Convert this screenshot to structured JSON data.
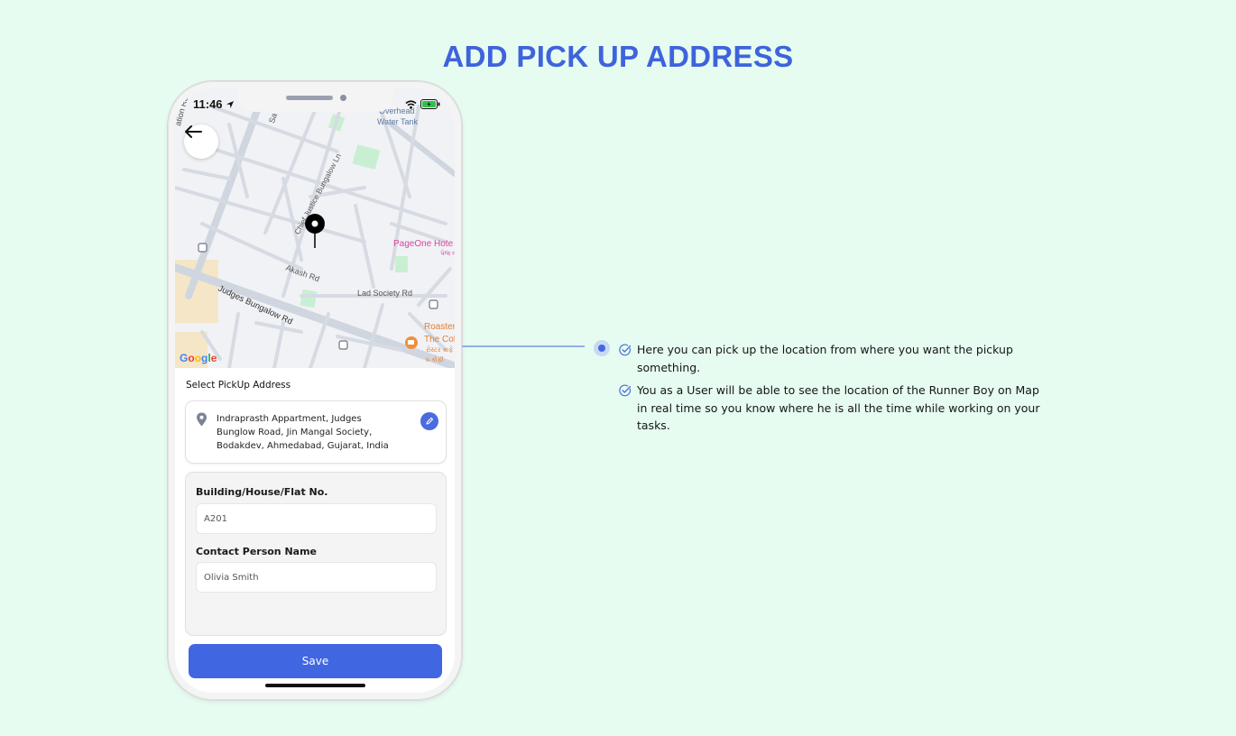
{
  "page": {
    "title": "ADD PICK UP ADDRESS"
  },
  "phone": {
    "status_time": "11:46",
    "map": {
      "labels": {
        "station_road": "ation Rd",
        "sarkhej_road": "Sa",
        "overhead": "Overhead",
        "water_tank": "Water Tank",
        "chief_bungalow_ln": "Chief Justice Bungalow Ln",
        "pageone_hotel": "PageOne Hote",
        "pageone_gujarati": "પેજ વ",
        "akash_rd": "Akash Rd",
        "lad_society_rd": "Lad Society Rd",
        "judges_bungalow_rd": "Judges Bungalow Rd",
        "roaster": "Roaster",
        "the_cof": "The Cof",
        "gujarati_cafe_1": "રોસ્ટર કાફે",
        "gujarati_cafe_2": "ધ કોફી"
      },
      "google": {
        "g1": "G",
        "o1": "o",
        "o2": "o",
        "g2": "g",
        "l": "l",
        "e": "e"
      }
    },
    "sheet": {
      "heading": "Select PickUp Address",
      "address_lines": [
        "Indraprasth Appartment, Judges",
        "Bunglow Road, Jin Mangal Society,",
        "Bodakdev, Ahmedabad, Gujarat, India"
      ],
      "building_label": "Building/House/Flat No.",
      "building_value": "A201",
      "contact_label": "Contact Person Name",
      "contact_value": "Olivia Smith",
      "save_label": "Save"
    }
  },
  "callout": {
    "notes": [
      "Here you can pick up the location from where you want the pickup something.",
      "You as a User will be able to see the location of the Runner Boy on Map in real time so you know where he is all the time while working on your tasks."
    ]
  },
  "colors": {
    "background": "#e6fcf1",
    "accent": "#3f63dc",
    "save_button": "#4166e2"
  }
}
